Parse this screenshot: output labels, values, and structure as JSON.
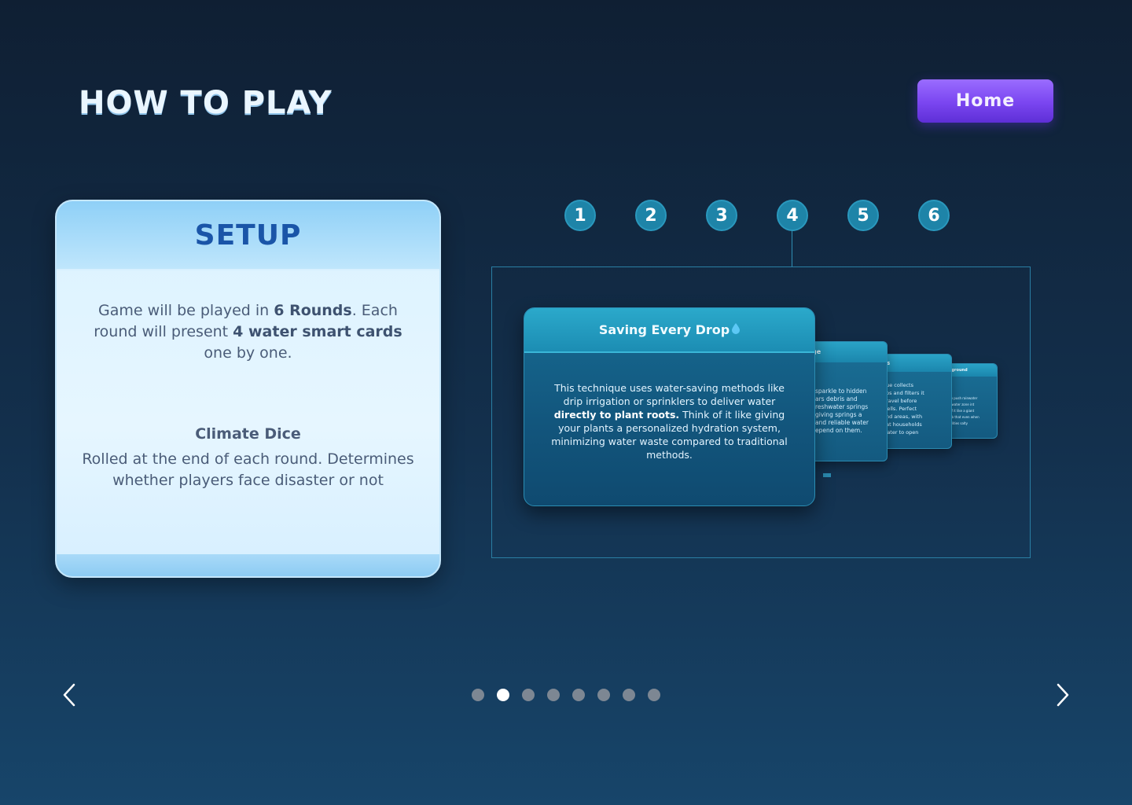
{
  "header": {
    "title": "HOW TO PLAY",
    "home_label": "Home"
  },
  "setup_card": {
    "title": "SETUP",
    "p1_a": "Game will be played in ",
    "p1_b": "6 Rounds",
    "p1_c": ". Each round will present ",
    "p1_d": "4 water smart cards",
    "p1_e": " one by one.",
    "dice_title": "Climate Dice",
    "dice_text": "Rolled at the end of each round. Determines whether players face disaster or not"
  },
  "steps": [
    "1",
    "2",
    "3",
    "4",
    "5",
    "6"
  ],
  "main_card": {
    "title": "Saving Every Drop",
    "body_a": "This technique uses water-saving methods like drip irrigation or sprinklers to deliver water ",
    "body_b": "directly to plant roots.",
    "body_c": " Think of it like giving your plants a personalized hydration system, minimizing water waste compared to traditional methods."
  },
  "back_cards": [
    {
      "title_fragment": "ge",
      "lines": [
        "sparkle to hidden",
        "ars debris and",
        "reshwater springs",
        "giving springs a",
        "and reliable water",
        "epend on them."
      ]
    },
    {
      "title_fragment": "ns",
      "lines": [
        "que collects",
        "ops and filters it",
        "gravel before",
        "wells. Perfect",
        "and areas, with",
        "hat households",
        "water to open"
      ]
    },
    {
      "title_fragment": "rground",
      "lines": [
        "to push rainwater",
        "dwater zone int",
        "of it like a giant",
        "ub that even when",
        "tilities salty"
      ]
    }
  ],
  "pagination": {
    "total": 8,
    "active_index": 1
  },
  "icons": {
    "prev": "chevron-left-icon",
    "next": "chevron-right-icon",
    "drop": "water-drop-icon"
  },
  "colors": {
    "accent_purple": "#7a45f0",
    "step_blue": "#1e84a8",
    "setup_title": "#1a55a8"
  }
}
